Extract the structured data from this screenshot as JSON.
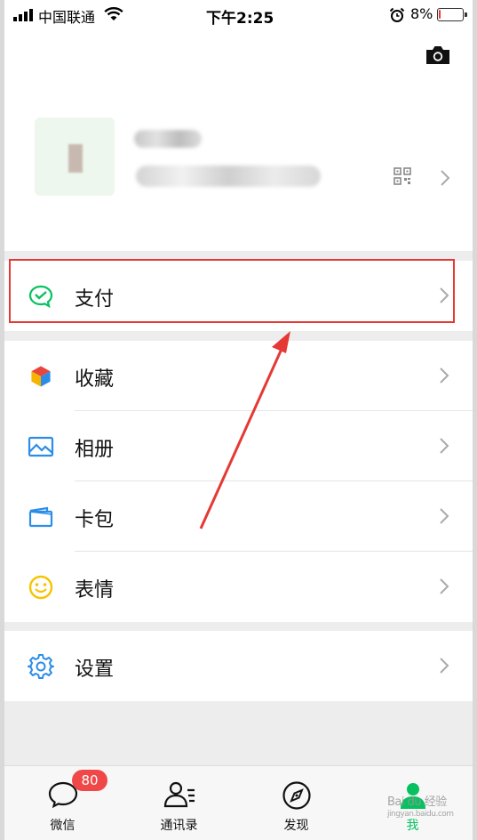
{
  "status_bar": {
    "carrier": "中国联通",
    "time": "下午2:25",
    "battery": "8%",
    "battery_level": 0.08,
    "battery_color": "#e53935"
  },
  "profile": {
    "camera_icon": "camera-icon",
    "qr_icon": "qr-code-icon",
    "chevron_icon": "chevron-right-icon"
  },
  "menu": {
    "pay": {
      "label": "支付",
      "icon": "wechat-pay-icon",
      "color": "#07c160"
    },
    "favorites": {
      "label": "收藏",
      "icon": "favorites-cube-icon"
    },
    "album": {
      "label": "相册",
      "icon": "album-icon",
      "color": "#2b8de8"
    },
    "cards": {
      "label": "卡包",
      "icon": "card-wallet-icon",
      "color": "#2b8de8"
    },
    "stickers": {
      "label": "表情",
      "icon": "smiley-icon",
      "color": "#f5c400"
    },
    "settings": {
      "label": "设置",
      "icon": "gear-icon",
      "color": "#2b8de8"
    }
  },
  "tabbar": {
    "chats": {
      "label": "微信",
      "badge": "80",
      "icon": "chat-bubble-icon"
    },
    "contacts": {
      "label": "通讯录",
      "icon": "contacts-icon"
    },
    "discover": {
      "label": "发现",
      "icon": "compass-icon"
    },
    "me": {
      "label": "我",
      "icon": "person-icon",
      "active": true,
      "color": "#07c160"
    }
  },
  "annotation": {
    "highlight_color": "#e53935"
  },
  "watermark": {
    "text": "Bai du 经验",
    "subtext": "jingyan.baidu.com"
  }
}
